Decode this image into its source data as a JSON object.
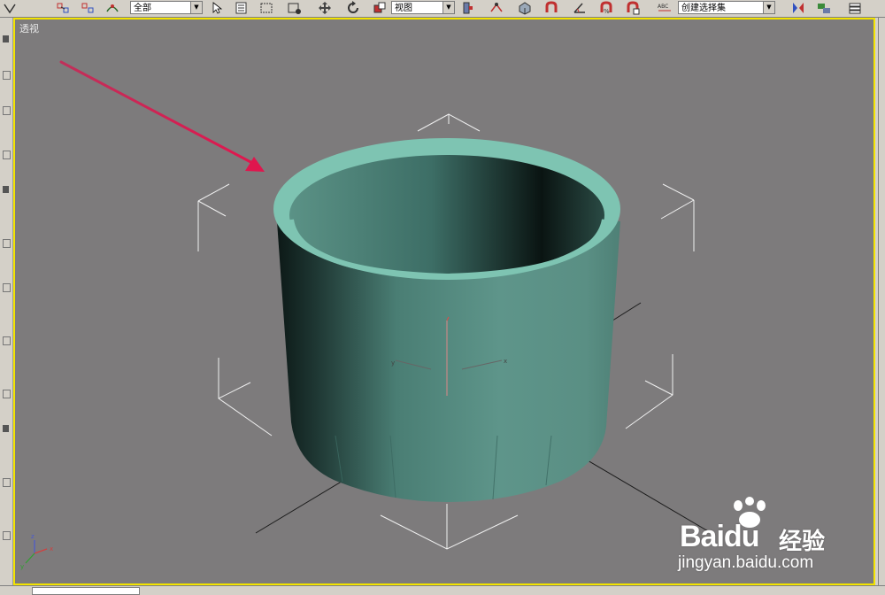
{
  "viewport": {
    "label": "透视",
    "border_color": "#f3e400",
    "background": "#7d7b7c",
    "object_color": "#6aa89a"
  },
  "toolbar": {
    "selection_filter": "全部",
    "reference_coordinate": "视图",
    "named_selection": "创建选择集",
    "icons": [
      "undo-icon",
      "select-link-icon",
      "unlink-icon",
      "bind-space-warp-icon",
      "select-object-icon",
      "select-by-name-icon",
      "rectangle-region-icon",
      "window-crossing-icon",
      "move-icon",
      "rotate-icon",
      "scale-icon",
      "pivot-center-icon",
      "select-manipulate-icon",
      "keyboard-shortcut-icon",
      "snap-toggle-icon",
      "angle-snap-icon",
      "percent-snap-icon",
      "spinner-snap-icon",
      "edit-named-selection-icon",
      "mirror-icon",
      "align-icon",
      "layer-manager-icon"
    ]
  },
  "axis_tripod": {
    "x": "x",
    "y": "y",
    "z": "z"
  },
  "watermark": {
    "brand": "Bai",
    "brand_suffix": "du",
    "cn": "经验",
    "url": "jingyan.baidu.com"
  }
}
